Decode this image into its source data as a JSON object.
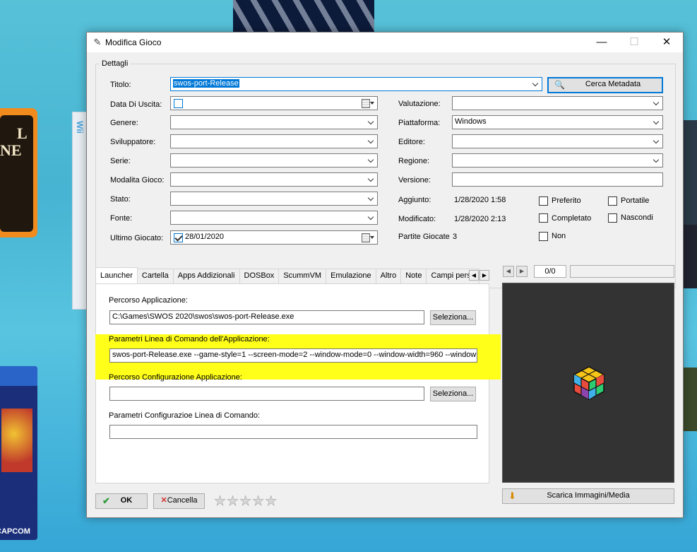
{
  "window": {
    "title": "Modifica Gioco"
  },
  "group_title": "Dettagli",
  "form": {
    "titolo_label": "Titolo:",
    "titolo_value": "swos-port-Release",
    "cerca_button": "Cerca Metadata",
    "data_uscita_label": "Data Di Uscita:",
    "genere_label": "Genere:",
    "sviluppatore_label": "Sviluppatore:",
    "serie_label": "Serie:",
    "modalita_label": "Modalita Gioco:",
    "stato_label": "Stato:",
    "fonte_label": "Fonte:",
    "ultimo_label": "Ultimo Giocato:",
    "ultimo_value": "28/01/2020",
    "valutazione_label": "Valutazione:",
    "piattaforma_label": "Piattaforma:",
    "piattaforma_value": "Windows",
    "editore_label": "Editore:",
    "regione_label": "Regione:",
    "versione_label": "Versione:",
    "aggiunto_label": "Aggiunto:",
    "aggiunto_value": "1/28/2020 1:58",
    "modificato_label": "Modificato:",
    "modificato_value": "1/28/2020 2:13",
    "partite_label": "Partite Giocate",
    "partite_value": "3",
    "preferito": "Preferito",
    "portatile": "Portatile",
    "completato": "Completato",
    "nascondi": "Nascondi",
    "non": "Non"
  },
  "tabs": [
    "Launcher",
    "Cartella",
    "Apps Addizionali",
    "DOSBox",
    "ScummVM",
    "Emulazione",
    "Altro",
    "Note",
    "Campi personalizzati"
  ],
  "launcher": {
    "percorso_label": "Percorso Applicazione:",
    "percorso_value": "C:\\Games\\SWOS 2020\\swos\\swos-port-Release.exe",
    "seleziona": "Seleziona...",
    "parametri_label": "Parametri Linea di Comando dell'Applicazione:",
    "parametri_value": "swos-port-Release.exe --game-style=1 --screen-mode=2 --window-mode=0 --window-width=960 --window",
    "config_label": "Percorso Configurazione Applicazione:",
    "config_value": "",
    "param_config_label": "Parametri Configurazioe Linea di Comando:",
    "param_config_value": ""
  },
  "images": {
    "counter": "0/0",
    "scarica_button": "Scarica Immagini/Media"
  },
  "footer": {
    "ok": "OK",
    "cancella": "Cancella",
    "rating": 0,
    "rating_max": 5
  },
  "background": {
    "left_card_text": [
      "L",
      "NE"
    ],
    "wii_text": "Wii",
    "capcom_text": "CAPCOM"
  }
}
